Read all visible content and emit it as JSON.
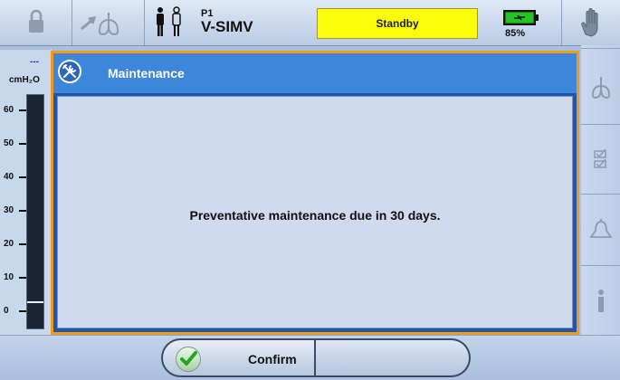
{
  "topbar": {
    "patient": "P1",
    "mode": "V-SIMV",
    "status": "Standby",
    "battery_percent": "85%",
    "icons": [
      "lock-icon",
      "lung-arrow-icon",
      "patient-icon",
      "battery-icon",
      "hand-icon"
    ],
    "status_color": "#fdfc0a"
  },
  "gauge": {
    "dash": "---",
    "unit": "cmH₂O",
    "ticks": [
      "60",
      "50",
      "40",
      "30",
      "20",
      "10",
      "0"
    ],
    "level_cmH2O": 3
  },
  "right_panel": {
    "icons": [
      "lungs-icon",
      "checklist-icon",
      "bell-icon",
      "info-icon"
    ]
  },
  "dialog": {
    "title": "Maintenance",
    "message": "Preventative maintenance due in 30 days.",
    "border_color": "#f29a1e",
    "header_color": "#3c86dc"
  },
  "bottombar": {
    "confirm_label": "Confirm"
  }
}
